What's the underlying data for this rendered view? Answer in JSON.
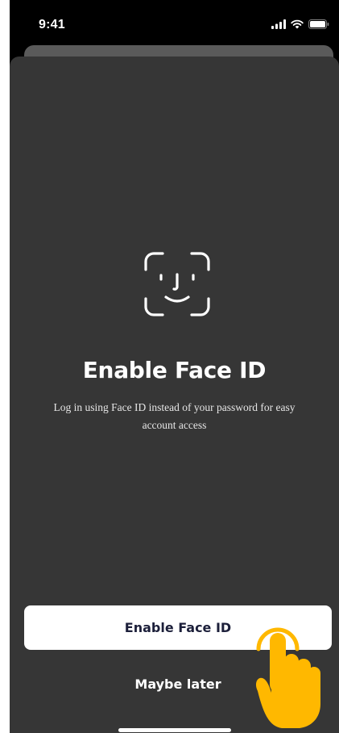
{
  "status_bar": {
    "time": "9:41",
    "icons": [
      "signal-icon",
      "wifi-icon",
      "battery-icon"
    ]
  },
  "sheet": {
    "icon": "face-id-icon",
    "title": "Enable Face ID",
    "description": "Log in using Face ID instead of your password for easy account access"
  },
  "actions": {
    "primary_label": "Enable Face ID",
    "secondary_label": "Maybe later"
  },
  "overlay": {
    "icon": "tap-hand-icon",
    "color": "#ffb800"
  },
  "colors": {
    "sheet_background": "#363636",
    "primary_button_bg": "#ffffff",
    "primary_button_text": "#1c1f3a"
  }
}
